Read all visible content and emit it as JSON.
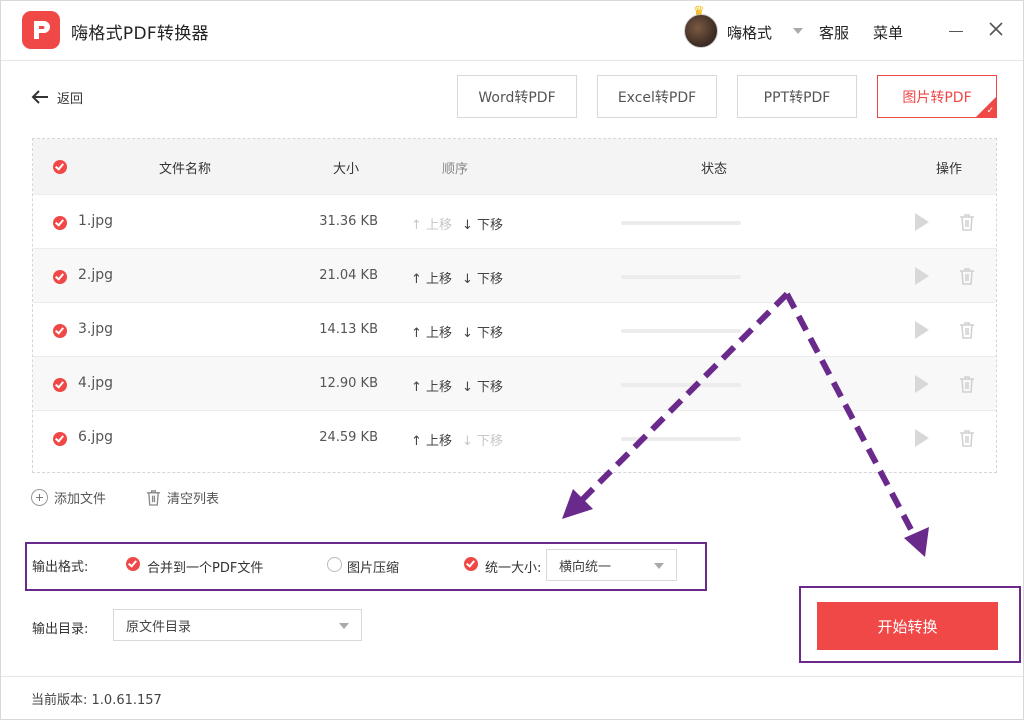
{
  "app": {
    "title": "嗨格式PDF转换器"
  },
  "header": {
    "username": "嗨格式",
    "service": "客服",
    "menu": "菜单"
  },
  "toolbar": {
    "back_label": "返回",
    "tabs": [
      {
        "label": "Word转PDF"
      },
      {
        "label": "Excel转PDF"
      },
      {
        "label": "PPT转PDF"
      },
      {
        "label": "图片转PDF"
      }
    ]
  },
  "table": {
    "headers": {
      "name": "文件名称",
      "size": "大小",
      "order": "顺序",
      "status": "状态",
      "action": "操作"
    },
    "move_up": "上移",
    "move_down": "下移",
    "rows": [
      {
        "name": "1.jpg",
        "size": "31.36 KB"
      },
      {
        "name": "2.jpg",
        "size": "21.04 KB"
      },
      {
        "name": "3.jpg",
        "size": "14.13 KB"
      },
      {
        "name": "4.jpg",
        "size": "12.90 KB"
      },
      {
        "name": "6.jpg",
        "size": "24.59 KB"
      }
    ]
  },
  "file_actions": {
    "add": "添加文件",
    "clear": "清空列表"
  },
  "output": {
    "format_label": "输出格式:",
    "merge_option": "合并到一个PDF文件",
    "compress_option": "图片压缩",
    "unify_size_label": "统一大小:",
    "unify_size_value": "横向统一",
    "dir_label": "输出目录:",
    "dir_value": "原文件目录"
  },
  "start_button": "开始转换",
  "footer": {
    "version_label": "当前版本:",
    "version": "1.0.61.157"
  },
  "colors": {
    "accent": "#f04747",
    "annotation": "#6a2a8c"
  }
}
